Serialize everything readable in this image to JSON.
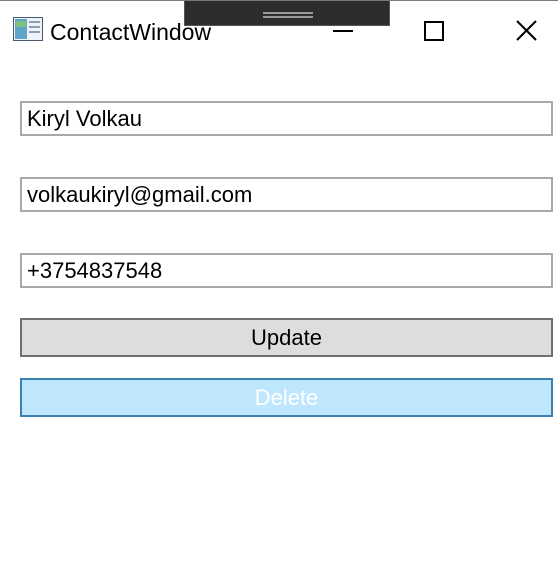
{
  "window": {
    "title": "ContactWindow",
    "app_icon": "window-app-icon",
    "controls": {
      "minimize_icon": "minimize-icon",
      "maximize_icon": "maximize-icon",
      "close_icon": "close-icon"
    }
  },
  "form": {
    "name_value": "Kiryl Volkau",
    "email_value": "volkaukiryl@gmail.com",
    "phone_value": "+3754837548",
    "update_label": "Update",
    "delete_label": "Delete"
  },
  "colors": {
    "update_bg": "#dddddd",
    "delete_bg": "#bee6fd",
    "delete_border": "#3c7fb1",
    "delete_text": "#ffffff"
  }
}
